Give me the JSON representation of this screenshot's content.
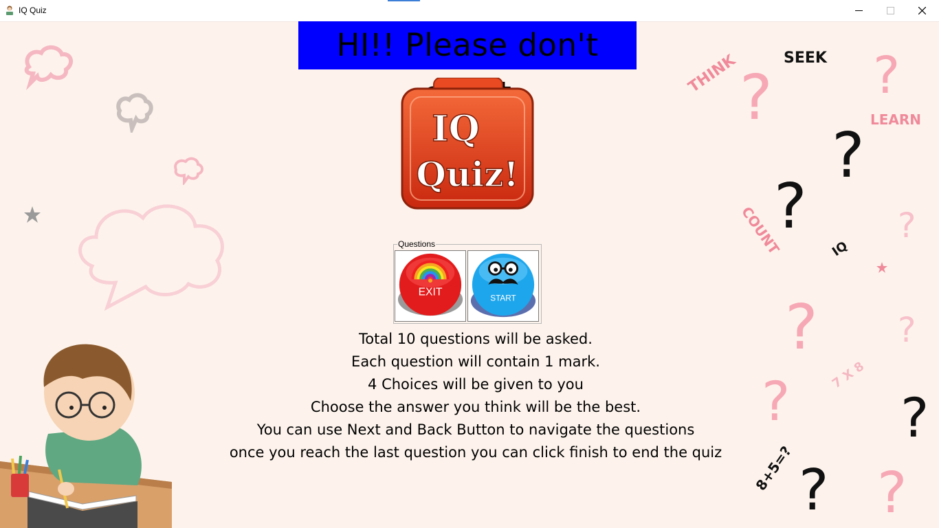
{
  "window": {
    "title": "IQ Quiz",
    "accent_color": "#3b7ed8"
  },
  "greeting": {
    "text": "HI!! Please don't cheat",
    "background": "#0000ff"
  },
  "logo": {
    "line1": "IQ",
    "line2": "Quiz!",
    "color": "#e2401c"
  },
  "questions_group": {
    "label": "Questions",
    "exit_button": {
      "label": "EXIT",
      "icon": "rainbow-icon",
      "color": "#e21c1c"
    },
    "start_button": {
      "label": "START",
      "icon": "glasses-mustache-icon",
      "color": "#1ea6ec"
    }
  },
  "instructions": [
    "Total 10 questions will be asked.",
    "Each question will contain 1 mark.",
    "4 Choices will be given to you",
    "Choose the answer you think will be the best.",
    "You can use Next and Back Button to navigate the questions",
    "once you reach the last question you can click finish to end the quiz"
  ],
  "decorations": {
    "words": [
      "THINK",
      "SEEK",
      "LEARN",
      "COUNT",
      "IQ",
      "7 X 8",
      "8+5=?"
    ],
    "pink_color": "#f08a9a",
    "question_mark": "?"
  }
}
